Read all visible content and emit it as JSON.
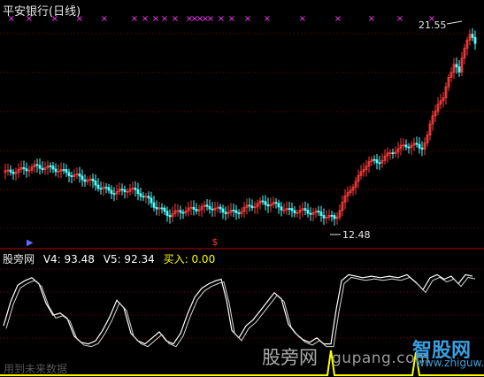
{
  "header": {
    "title": "平安银行(日线)"
  },
  "price_labels": {
    "high": "21.55",
    "low": "12.48"
  },
  "indicator": {
    "name": "股旁网",
    "v4": "V4: 93.48",
    "v5": "V5: 92.34",
    "buy": "买入: 0.00"
  },
  "watermarks": {
    "cn": "股旁网",
    "url": "gupang.com",
    "logo": "智股网",
    "logo_url": "www.zhiguw.com",
    "dim_text": "用到未来数据"
  },
  "colors": {
    "background": "#000000",
    "grid": "#8b0000",
    "up_candle": "#ff3c3c",
    "down_candle": "#54ffff",
    "marker": "#ff3cff",
    "line_white": "#ffffff",
    "signal_yellow": "#ffff00"
  },
  "chart_data": {
    "type": "candlestick",
    "series": [
      {
        "name": "平安银行",
        "ylim": [
          11.5,
          22.5
        ]
      },
      {
        "name": "V4",
        "last": 93.48
      },
      {
        "name": "V5",
        "last": 92.34
      },
      {
        "name": "买入",
        "last": 0.0
      }
    ]
  }
}
